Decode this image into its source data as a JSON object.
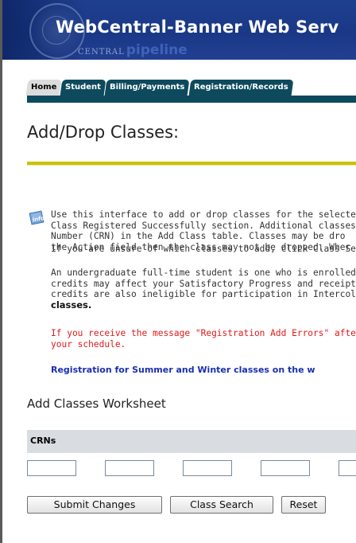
{
  "header": {
    "title": "WebCentral-Banner Web Serv",
    "sub_central": "CENTRAL",
    "sub_pipeline": "pipeline"
  },
  "tabs": [
    {
      "label": "Home",
      "active": true
    },
    {
      "label": "Student",
      "active": false
    },
    {
      "label": "Billing/Payments",
      "active": false
    },
    {
      "label": "Registration/Records",
      "active": false
    }
  ],
  "page": {
    "title": "Add/Drop Classes:"
  },
  "info": {
    "icon": "info-icon",
    "p1": [
      "Use this interface to add or drop classes for the selected",
      "Class Registered Successfully section. Additional classes",
      "Number (CRN) in the Add Class table. Classes may be dro",
      "the Action field then the class may not be dropped. Wher"
    ],
    "p2": "If you are unsure of which classes to add, click Class Sea",
    "p3": [
      "An undergraduate full-time student is one who is enrolled",
      "credits may affect your Satisfactory Progress and receipt",
      "credits are also ineligible for participation in Intercollegiat"
    ],
    "p3_bold": "classes.",
    "p4": [
      "If you receive the message \"Registration Add Errors\" afte",
      "your schedule."
    ],
    "p5": "Registration for Summer and Winter classes on the w"
  },
  "worksheet": {
    "title": "Add Classes Worksheet",
    "crn_label": "CRNs",
    "crn_values": [
      "",
      "",
      "",
      "",
      ""
    ]
  },
  "buttons": {
    "submit": "Submit Changes",
    "class_search": "Class Search",
    "reset": "Reset"
  },
  "colors": {
    "banner": "#1f3f8f",
    "tab": "#0e4a5d",
    "rule": "#c9c200",
    "error_text": "#e01a1a",
    "notice_text": "#1a2fb0"
  }
}
